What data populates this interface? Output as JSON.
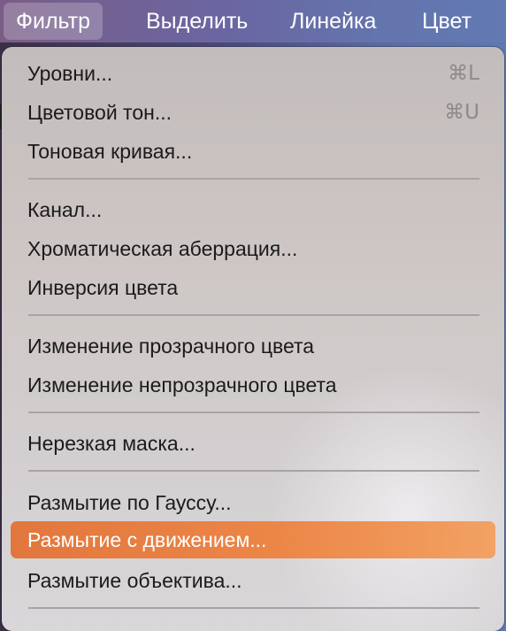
{
  "menubar": {
    "items": [
      {
        "label": "Фильтр",
        "active": true
      },
      {
        "label": "Выделить"
      },
      {
        "label": "Линейка"
      },
      {
        "label": "Цвет"
      }
    ]
  },
  "menu": {
    "items": [
      {
        "label": "Уровни...",
        "shortcut": "⌘L"
      },
      {
        "label": "Цветовой тон...",
        "shortcut": "⌘U"
      },
      {
        "label": "Тоновая кривая..."
      },
      {
        "label": "Канал..."
      },
      {
        "label": "Хроматическая аберрация..."
      },
      {
        "label": "Инверсия цвета"
      },
      {
        "label": "Изменение прозрачного цвета"
      },
      {
        "label": "Изменение непрозрачного цвета"
      },
      {
        "label": "Нерезкая маска..."
      },
      {
        "label": "Размытие по Гауссу..."
      },
      {
        "label": "Размытие с движением...",
        "highlighted": true
      },
      {
        "label": "Размытие объектива..."
      }
    ]
  },
  "colors": {
    "highlight": "#ec8647",
    "menu_bg": "#cdc6c4",
    "menubar_bg": "#6a66a2"
  }
}
